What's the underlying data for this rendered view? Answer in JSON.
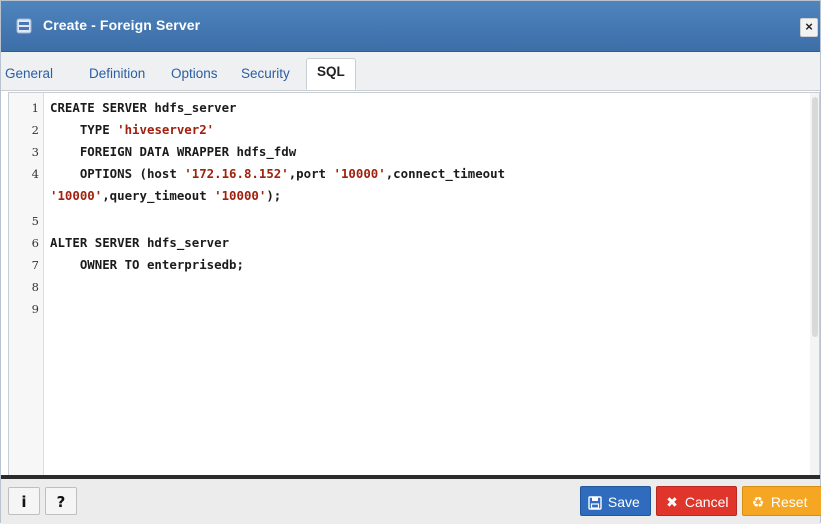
{
  "window": {
    "title": "Create - Foreign Server",
    "close_label": "×"
  },
  "tabs": [
    {
      "label": "General"
    },
    {
      "label": "Definition"
    },
    {
      "label": "Options"
    },
    {
      "label": "Security"
    },
    {
      "label": "SQL",
      "active": true
    }
  ],
  "editor": {
    "line_numbers": [
      "1",
      "2",
      "3",
      "4",
      "5",
      "6",
      "7",
      "8",
      "9"
    ],
    "code": {
      "l1": "CREATE SERVER hdfs_server",
      "l2_pre": "    TYPE ",
      "l2_str": "'hiveserver2'",
      "l3": "    FOREIGN DATA WRAPPER hdfs_fdw",
      "l4_pre": "    OPTIONS (host ",
      "l4_str1": "'172.16.8.152'",
      "l4_mid": ",port ",
      "l4_str2": "'10000'",
      "l4_post": ",connect_timeout",
      "l4b_str1": "'10000'",
      "l4b_mid": ",query_timeout ",
      "l4b_str2": "'10000'",
      "l4b_post": ");",
      "l6": "ALTER SERVER hdfs_server",
      "l7": "    OWNER TO enterprisedb;"
    }
  },
  "footer": {
    "info_label": "i",
    "help_label": "?",
    "save_label": "Save",
    "cancel_label": "Cancel",
    "reset_label": "Reset"
  },
  "colors": {
    "titlebar": "#3c6ea8",
    "string": "#a1200e",
    "save": "#2f6cbd",
    "cancel": "#e0352b",
    "reset": "#f5a623"
  }
}
